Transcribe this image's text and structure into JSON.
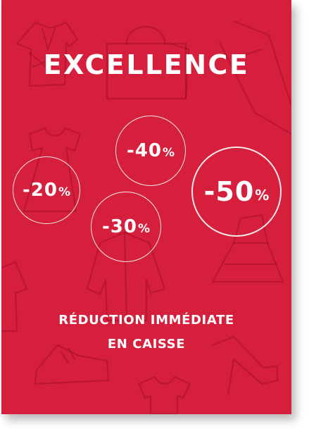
{
  "colors": {
    "background": "#d61f3c",
    "text": "#ffffff",
    "pattern": "#8a0a22"
  },
  "title": "EXCELLENCE",
  "discounts": [
    {
      "value": "-20",
      "unit": "%"
    },
    {
      "value": "-40",
      "unit": "%"
    },
    {
      "value": "-30",
      "unit": "%"
    },
    {
      "value": "-50",
      "unit": "%"
    }
  ],
  "subtitle_line1": "RÉDUCTION IMMÉDIATE",
  "subtitle_line2": "EN CAISSE",
  "pattern_icons": [
    "shirt-icon",
    "shopping-bag-icon",
    "trousers-icon",
    "dress-icon",
    "jacket-icon",
    "skirt-icon",
    "shoe-icon",
    "high-heel-icon",
    "tshirt-icon"
  ]
}
